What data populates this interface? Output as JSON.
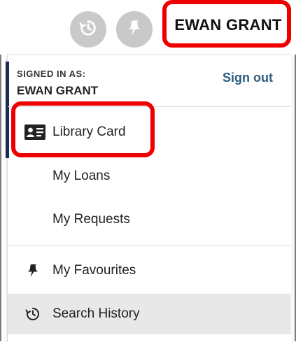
{
  "topbar": {
    "history_button": {
      "icon": "history-icon"
    },
    "pin_button": {
      "icon": "pin-icon"
    },
    "user_name": "EWAN GRANT"
  },
  "menu": {
    "signed_in_label": "SIGNED IN AS:",
    "signed_in_user": "EWAN GRANT",
    "sign_out": "Sign out",
    "items": [
      {
        "label": "Library Card",
        "icon": "id-card-icon"
      },
      {
        "label": "My Loans"
      },
      {
        "label": "My Requests"
      },
      {
        "label": "My Favourites",
        "icon": "pin-icon"
      },
      {
        "label": "Search History",
        "icon": "history-icon"
      }
    ]
  },
  "colors": {
    "highlight": "#ee0000",
    "link": "#2b5c7e",
    "accent": "#1c2b52",
    "icon_button_bg": "#c9c9c9"
  }
}
